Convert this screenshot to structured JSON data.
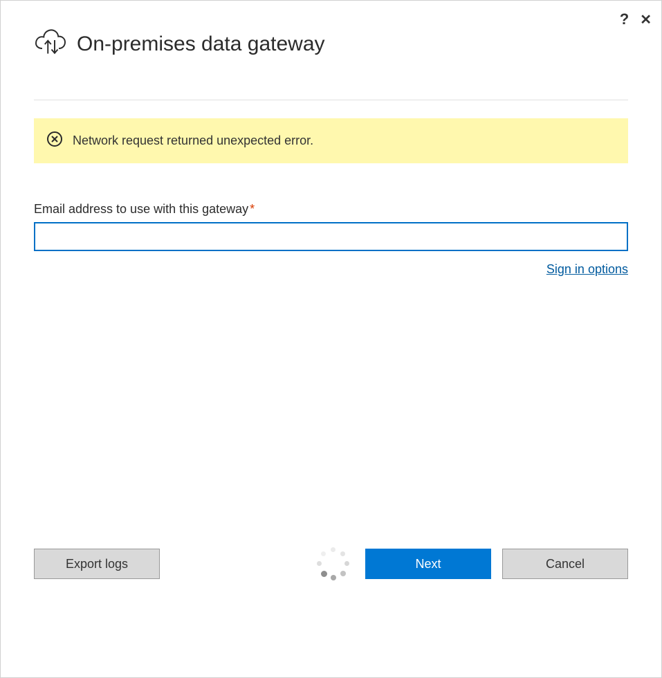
{
  "header": {
    "title": "On-premises data gateway"
  },
  "titlebar": {
    "help": "?",
    "close": "✕"
  },
  "banner": {
    "message": "Network request returned unexpected error."
  },
  "form": {
    "email_label": "Email address to use with this gateway",
    "required_marker": "*",
    "email_value": "",
    "sign_in_options": "Sign in options"
  },
  "footer": {
    "export_logs": "Export logs",
    "next": "Next",
    "cancel": "Cancel"
  }
}
